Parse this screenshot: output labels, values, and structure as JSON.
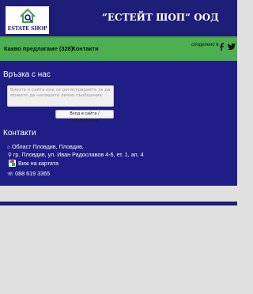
{
  "header": {
    "logo_text": "ESTATE SHOP",
    "brand": "”ЕСТЕЙТ ШОП” ООД"
  },
  "nav": {
    "items": [
      {
        "label": "Какво предлагаме (328)"
      },
      {
        "label": "Контакти"
      }
    ],
    "share_label": "споделено в",
    "icons": [
      "facebook-icon",
      "twitter-icon"
    ]
  },
  "contact_form": {
    "title": "Връзка с нас",
    "placeholder": "Влезте в сайта или се регистрирайте за да можете да напишете лично съобщение.",
    "login_button": "Вход в сайта / Регистрация"
  },
  "contacts": {
    "title": "Контакти",
    "region": "Област Пловдив, Пловдив,",
    "address": "гр. Пловдив, ул. Иван Радославов 4-6, ет. 1, ап. 4",
    "map_link": "Виж на картата",
    "phone": "088 619 3365"
  },
  "colors": {
    "primary": "#1e1e78",
    "accent": "#4caf50",
    "background": "#e0e0e0"
  }
}
